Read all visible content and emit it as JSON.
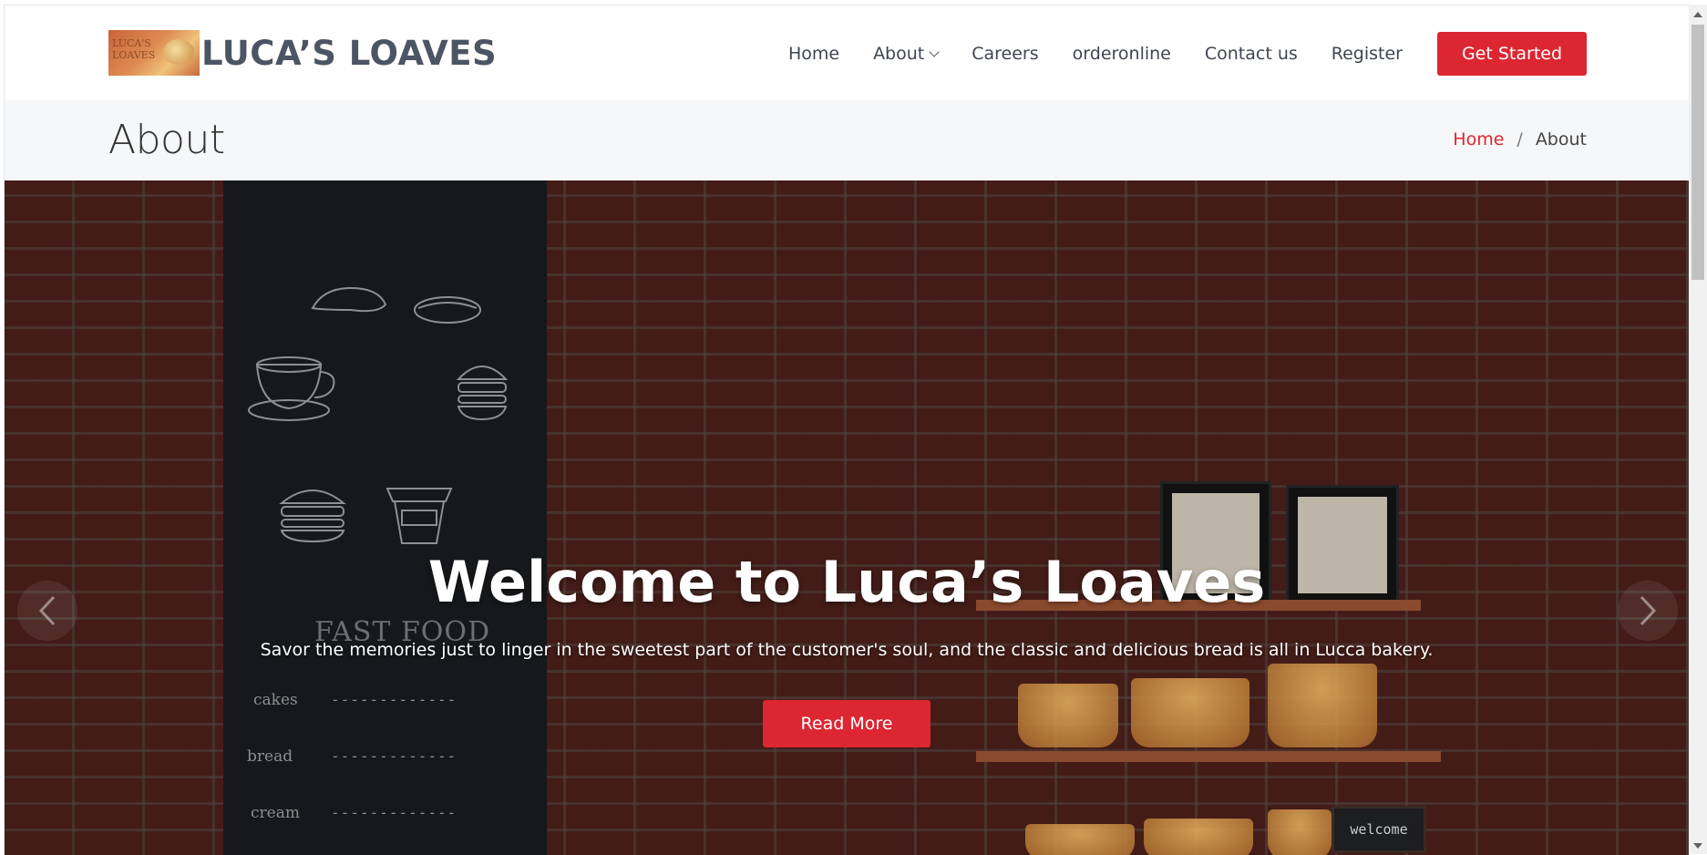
{
  "header": {
    "logo_image_text": "LUCA'S LOAVES",
    "logo_text": "LUCA’S LOAVES",
    "nav": [
      "Home",
      "About",
      "Careers",
      "orderonline",
      "Contact us",
      "Register"
    ],
    "cta_label": "Get Started"
  },
  "page": {
    "title": "About",
    "breadcrumb": {
      "home": "Home",
      "separator": "/",
      "current": "About"
    }
  },
  "hero": {
    "title": "Welcome to Luca’s Loaves",
    "subtitle": "Savor the memories just to linger in the sweetest part of the customer's soul, and the classic and delicious bread is all in Lucca bakery.",
    "button_label": "Read More",
    "board": {
      "heading": "FAST FOOD",
      "items": [
        "cakes",
        "bread",
        "cream"
      ],
      "dash": "-------------"
    },
    "sign_text": "welcome"
  },
  "colors": {
    "accent": "#dc2632",
    "nav_text": "#3f4550",
    "logo_text": "#4c5564",
    "breadcrumb_bg": "#f6f7f8"
  },
  "icons": {
    "prev": "chevron-left-icon",
    "next": "chevron-right-icon",
    "dropdown": "chevron-down-icon"
  }
}
